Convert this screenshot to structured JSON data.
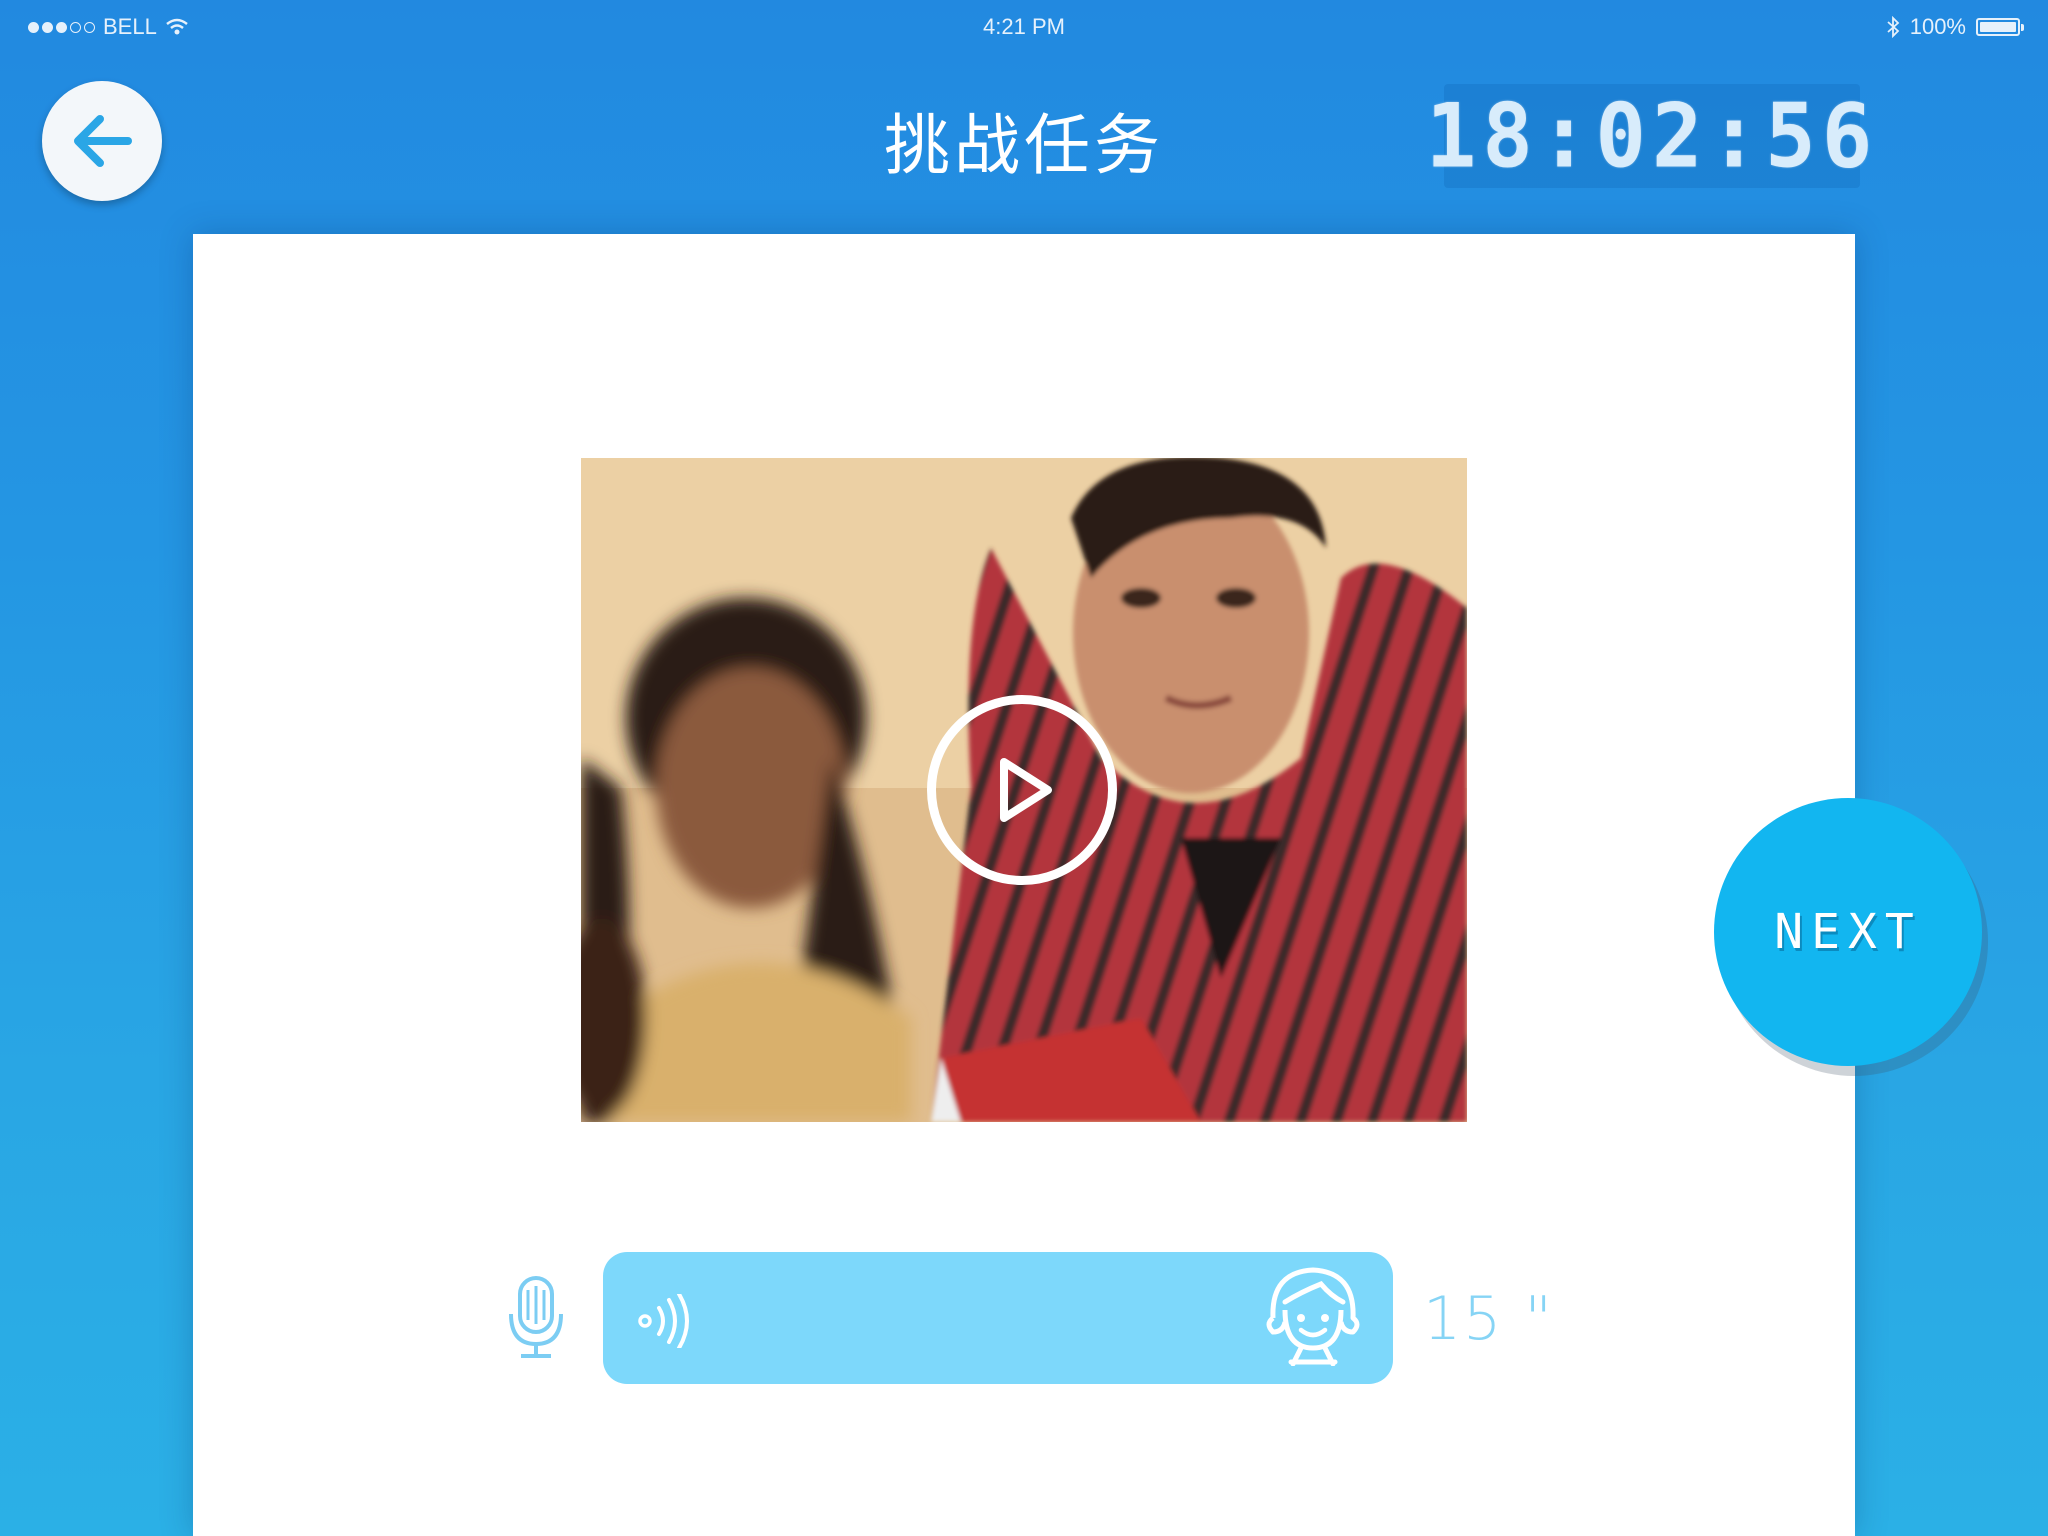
{
  "status_bar": {
    "carrier": "BELL",
    "time": "4:21 PM",
    "battery": "100%"
  },
  "header": {
    "title": "挑战任务",
    "timer": "18:02:56"
  },
  "audio": {
    "duration": "15 \""
  },
  "next_button": {
    "label": "NEXT"
  },
  "icons": {
    "back": "arrow-left-icon",
    "play": "play-icon",
    "mic": "microphone-icon",
    "sound": "sound-waves-icon",
    "face": "child-face-icon"
  },
  "colors": {
    "background_top": "#2289e0",
    "background_bottom": "#2bb0e6",
    "accent": "#12b6f0",
    "audio_bar": "#7dd8fb",
    "icon_blue": "#2aa6e6"
  }
}
